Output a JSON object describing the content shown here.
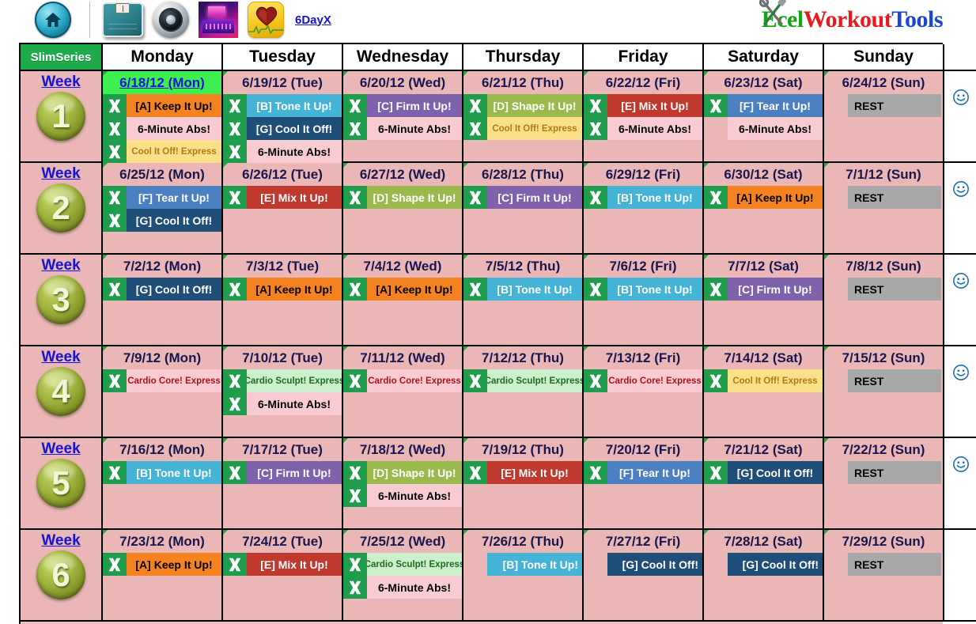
{
  "toolbar": {
    "icons": [
      {
        "name": "home-icon",
        "title": "Home"
      },
      {
        "name": "scale-icon",
        "title": "Weight Scale"
      },
      {
        "name": "camera-icon",
        "title": "Photo"
      },
      {
        "name": "register-icon",
        "title": "Calculator"
      },
      {
        "name": "heart-rate-icon",
        "title": "Heart Rate"
      }
    ],
    "link_label": "6DayX"
  },
  "logo": {
    "part1": "E",
    "part2": "cel",
    "part3": "Workout",
    "part4": "Tools",
    "colors": {
      "excel": "#17a317",
      "workout": "#e81a1a",
      "tools": "#1a46cf"
    }
  },
  "header": {
    "corner_label": "SlimSeries",
    "days": [
      "Monday",
      "Tuesday",
      "Wednesday",
      "Thursday",
      "Friday",
      "Saturday",
      "Sunday"
    ]
  },
  "styles": {
    "A": {
      "bg": "#f58220",
      "fg": "#000000"
    },
    "B": {
      "bg": "#44b3d6",
      "fg": "#ffffff"
    },
    "C": {
      "bg": "#7f62ab",
      "fg": "#ffffff"
    },
    "D": {
      "bg": "#9cb94d",
      "fg": "#ffffff"
    },
    "E": {
      "bg": "#c0392f",
      "fg": "#ffffff"
    },
    "F": {
      "bg": "#4a7fc1",
      "fg": "#ffffff"
    },
    "G": {
      "bg": "#1f4e79",
      "fg": "#ffffff"
    },
    "abs": {
      "bg": "#f9ccd3",
      "fg": "#000000"
    },
    "coolexpress": {
      "bg": "#fbe08a",
      "fg": "#b07a10"
    },
    "cardiocore": {
      "bg": "#f9ccd3",
      "fg": "#b31016"
    },
    "cardiosculpt": {
      "bg": "#ccf0cc",
      "fg": "#1d6b1d"
    },
    "rest": {
      "bg": "#a8a8a8",
      "fg": "#000000"
    },
    "cellbg": "#eab6b6",
    "today_bg": "#3ef04f",
    "slimseries_bg": "#1faa4b"
  },
  "weeks": [
    {
      "label": "Week",
      "number": "1",
      "smiley": true,
      "days": [
        {
          "date": "6/18/12 (Mon)",
          "today": true,
          "items": [
            {
              "text": "[A] Keep It Up!",
              "style": "A",
              "x": true,
              "align": "ctr"
            },
            {
              "text": "6-Minute Abs!",
              "style": "abs",
              "x": true,
              "align": "ctr"
            },
            {
              "text": "Cool It Off! Express",
              "style": "coolexpress",
              "x": true,
              "align": "ctr",
              "small": true
            }
          ]
        },
        {
          "date": "6/19/12 (Tue)",
          "today": false,
          "items": [
            {
              "text": "[B] Tone It Up!",
              "style": "B",
              "x": true,
              "align": "ctr"
            },
            {
              "text": "[G] Cool It Off!",
              "style": "G",
              "x": true,
              "align": "ctr"
            },
            {
              "text": "6-Minute Abs!",
              "style": "abs",
              "x": true,
              "align": "ctr"
            }
          ]
        },
        {
          "date": "6/20/12 (Wed)",
          "today": false,
          "items": [
            {
              "text": "[C] Firm It Up!",
              "style": "C",
              "x": true,
              "align": "ctr"
            },
            {
              "text": "6-Minute Abs!",
              "style": "abs",
              "x": true,
              "align": "ctr"
            }
          ]
        },
        {
          "date": "6/21/12 (Thu)",
          "today": false,
          "items": [
            {
              "text": "[D] Shape It Up!",
              "style": "D",
              "x": true,
              "align": "ctr"
            },
            {
              "text": "Cool It Off! Express",
              "style": "coolexpress",
              "x": true,
              "align": "ctr",
              "small": true
            }
          ]
        },
        {
          "date": "6/22/12 (Fri)",
          "today": false,
          "items": [
            {
              "text": "[E] Mix It Up!",
              "style": "E",
              "x": true,
              "align": "ctr"
            },
            {
              "text": "6-Minute Abs!",
              "style": "abs",
              "x": true,
              "align": "ctr"
            }
          ]
        },
        {
          "date": "6/23/12 (Sat)",
          "today": false,
          "items": [
            {
              "text": "[F] Tear It Up!",
              "style": "F",
              "x": true,
              "align": "ctr"
            },
            {
              "text": "6-Minute Abs!",
              "style": "abs",
              "x": false,
              "align": "ctr",
              "indent": true
            }
          ]
        },
        {
          "date": "6/24/12 (Sun)",
          "today": false,
          "items": [
            {
              "text": "REST",
              "style": "rest",
              "x": false,
              "align": "lft",
              "indent": true
            }
          ]
        }
      ]
    },
    {
      "label": "Week",
      "number": "2",
      "smiley": true,
      "days": [
        {
          "date": "6/25/12 (Mon)",
          "today": false,
          "items": [
            {
              "text": "[F] Tear It Up!",
              "style": "F",
              "x": true,
              "align": "ctr"
            },
            {
              "text": "[G] Cool It Off!",
              "style": "G",
              "x": true,
              "align": "ctr"
            }
          ]
        },
        {
          "date": "6/26/12 (Tue)",
          "today": false,
          "items": [
            {
              "text": "[E] Mix It Up!",
              "style": "E",
              "x": true,
              "align": "ctr"
            }
          ]
        },
        {
          "date": "6/27/12 (Wed)",
          "today": false,
          "items": [
            {
              "text": "[D] Shape It Up!",
              "style": "D",
              "x": true,
              "align": "ctr"
            }
          ]
        },
        {
          "date": "6/28/12 (Thu)",
          "today": false,
          "items": [
            {
              "text": "[C] Firm It Up!",
              "style": "C",
              "x": true,
              "align": "ctr"
            }
          ]
        },
        {
          "date": "6/29/12 (Fri)",
          "today": false,
          "items": [
            {
              "text": "[B] Tone It Up!",
              "style": "B",
              "x": true,
              "align": "ctr"
            }
          ]
        },
        {
          "date": "6/30/12 (Sat)",
          "today": false,
          "items": [
            {
              "text": "[A] Keep It Up!",
              "style": "A",
              "x": true,
              "align": "ctr"
            }
          ]
        },
        {
          "date": "7/1/12 (Sun)",
          "today": false,
          "items": [
            {
              "text": "REST",
              "style": "rest",
              "x": false,
              "align": "lft",
              "indent": true
            }
          ]
        }
      ]
    },
    {
      "label": "Week",
      "number": "3",
      "smiley": true,
      "days": [
        {
          "date": "7/2/12 (Mon)",
          "today": false,
          "items": [
            {
              "text": "[G] Cool It Off!",
              "style": "G",
              "x": true,
              "align": "ctr"
            }
          ]
        },
        {
          "date": "7/3/12 (Tue)",
          "today": false,
          "items": [
            {
              "text": "[A] Keep It Up!",
              "style": "A",
              "x": true,
              "align": "ctr"
            }
          ]
        },
        {
          "date": "7/4/12 (Wed)",
          "today": false,
          "items": [
            {
              "text": "[A] Keep It Up!",
              "style": "A",
              "x": true,
              "align": "ctr"
            }
          ]
        },
        {
          "date": "7/5/12 (Thu)",
          "today": false,
          "items": [
            {
              "text": "[B] Tone It Up!",
              "style": "B",
              "x": true,
              "align": "ctr"
            }
          ]
        },
        {
          "date": "7/6/12 (Fri)",
          "today": false,
          "items": [
            {
              "text": "[B] Tone It Up!",
              "style": "B",
              "x": true,
              "align": "ctr"
            }
          ]
        },
        {
          "date": "7/7/12 (Sat)",
          "today": false,
          "items": [
            {
              "text": "[C] Firm It Up!",
              "style": "C",
              "x": true,
              "align": "ctr"
            }
          ]
        },
        {
          "date": "7/8/12 (Sun)",
          "today": false,
          "items": [
            {
              "text": "REST",
              "style": "rest",
              "x": false,
              "align": "lft",
              "indent": true
            }
          ]
        }
      ]
    },
    {
      "label": "Week",
      "number": "4",
      "smiley": true,
      "days": [
        {
          "date": "7/9/12 (Mon)",
          "today": false,
          "items": [
            {
              "text": "Cardio Core! Express",
              "style": "cardiocore",
              "x": true,
              "align": "ctr",
              "small": true
            }
          ]
        },
        {
          "date": "7/10/12 (Tue)",
          "today": false,
          "items": [
            {
              "text": "Cardio Sculpt! Express",
              "style": "cardiosculpt",
              "x": true,
              "align": "ctr",
              "small": true
            },
            {
              "text": "6-Minute Abs!",
              "style": "abs",
              "x": true,
              "align": "ctr"
            }
          ]
        },
        {
          "date": "7/11/12 (Wed)",
          "today": false,
          "items": [
            {
              "text": "Cardio Core! Express",
              "style": "cardiocore",
              "x": true,
              "align": "ctr",
              "small": true
            }
          ]
        },
        {
          "date": "7/12/12 (Thu)",
          "today": false,
          "items": [
            {
              "text": "Cardio Sculpt! Express",
              "style": "cardiosculpt",
              "x": true,
              "align": "ctr",
              "small": true
            }
          ]
        },
        {
          "date": "7/13/12 (Fri)",
          "today": false,
          "items": [
            {
              "text": "Cardio Core! Express",
              "style": "cardiocore",
              "x": true,
              "align": "ctr",
              "small": true
            }
          ]
        },
        {
          "date": "7/14/12 (Sat)",
          "today": false,
          "items": [
            {
              "text": "Cool It Off! Express",
              "style": "coolexpress",
              "x": true,
              "align": "ctr",
              "small": true
            }
          ]
        },
        {
          "date": "7/15/12 (Sun)",
          "today": false,
          "items": [
            {
              "text": "REST",
              "style": "rest",
              "x": false,
              "align": "lft",
              "indent": true
            }
          ]
        }
      ]
    },
    {
      "label": "Week",
      "number": "5",
      "smiley": true,
      "days": [
        {
          "date": "7/16/12 (Mon)",
          "today": false,
          "items": [
            {
              "text": "[B] Tone It Up!",
              "style": "B",
              "x": true,
              "align": "ctr"
            }
          ]
        },
        {
          "date": "7/17/12 (Tue)",
          "today": false,
          "items": [
            {
              "text": "[C] Firm It Up!",
              "style": "C",
              "x": true,
              "align": "ctr"
            }
          ]
        },
        {
          "date": "7/18/12 (Wed)",
          "today": false,
          "items": [
            {
              "text": "[D] Shape It Up!",
              "style": "D",
              "x": true,
              "align": "ctr"
            },
            {
              "text": "6-Minute Abs!",
              "style": "abs",
              "x": true,
              "align": "ctr"
            }
          ]
        },
        {
          "date": "7/19/12 (Thu)",
          "today": false,
          "items": [
            {
              "text": "[E] Mix It Up!",
              "style": "E",
              "x": true,
              "align": "ctr"
            }
          ]
        },
        {
          "date": "7/20/12 (Fri)",
          "today": false,
          "items": [
            {
              "text": "[F] Tear It Up!",
              "style": "F",
              "x": true,
              "align": "ctr"
            }
          ]
        },
        {
          "date": "7/21/12 (Sat)",
          "today": false,
          "items": [
            {
              "text": "[G] Cool It Off!",
              "style": "G",
              "x": true,
              "align": "ctr"
            }
          ]
        },
        {
          "date": "7/22/12 (Sun)",
          "today": false,
          "items": [
            {
              "text": "REST",
              "style": "rest",
              "x": false,
              "align": "lft",
              "indent": true
            }
          ]
        }
      ]
    },
    {
      "label": "Week",
      "number": "6",
      "smiley": false,
      "days": [
        {
          "date": "7/23/12 (Mon)",
          "today": false,
          "items": [
            {
              "text": "[A] Keep It Up!",
              "style": "A",
              "x": true,
              "align": "ctr"
            }
          ]
        },
        {
          "date": "7/24/12 (Tue)",
          "today": false,
          "items": [
            {
              "text": "[E] Mix It Up!",
              "style": "E",
              "x": true,
              "align": "ctr"
            }
          ]
        },
        {
          "date": "7/25/12 (Wed)",
          "today": false,
          "items": [
            {
              "text": "Cardio Sculpt! Express",
              "style": "cardiosculpt",
              "x": true,
              "align": "ctr",
              "small": true
            },
            {
              "text": "6-Minute Abs!",
              "style": "abs",
              "x": true,
              "align": "ctr"
            }
          ]
        },
        {
          "date": "7/26/12 (Thu)",
          "today": false,
          "items": [
            {
              "text": "[B] Tone It Up!",
              "style": "B",
              "x": false,
              "align": "rgt",
              "indent": true
            }
          ]
        },
        {
          "date": "7/27/12 (Fri)",
          "today": false,
          "items": [
            {
              "text": "[G] Cool It Off!",
              "style": "G",
              "x": false,
              "align": "rgt",
              "indent": true
            }
          ]
        },
        {
          "date": "7/28/12 (Sat)",
          "today": false,
          "items": [
            {
              "text": "[G] Cool It Off!",
              "style": "G",
              "x": false,
              "align": "rgt",
              "indent": true
            }
          ]
        },
        {
          "date": "7/29/12 (Sun)",
          "today": false,
          "items": [
            {
              "text": "REST",
              "style": "rest",
              "x": false,
              "align": "lft",
              "indent": true
            }
          ]
        }
      ]
    }
  ]
}
